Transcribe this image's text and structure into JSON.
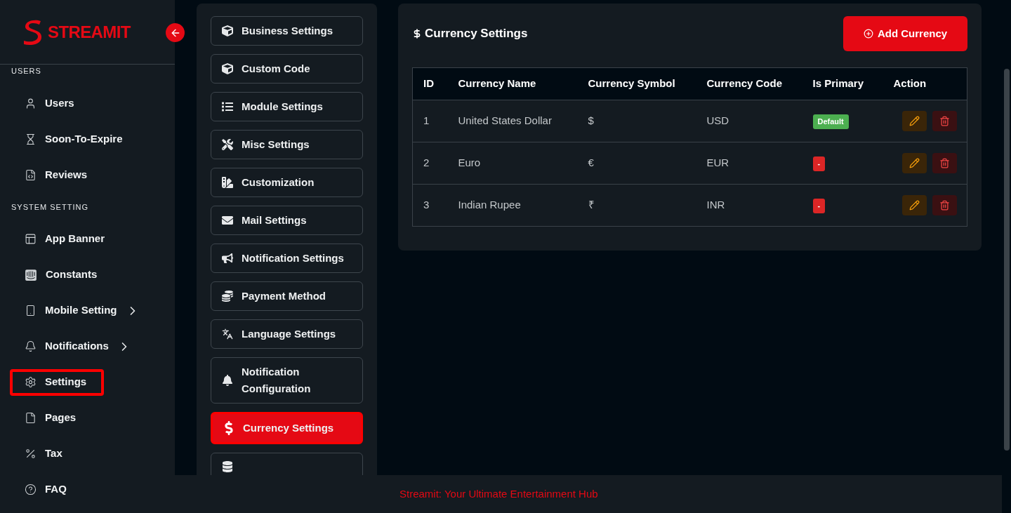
{
  "brand": {
    "name": "STREAMIT"
  },
  "sidebar": {
    "sections": [
      {
        "title": "USERS",
        "items": [
          {
            "label": "Users",
            "selected": false,
            "has_submenu": false
          },
          {
            "label": "Soon-To-Expire",
            "selected": false,
            "has_submenu": false
          },
          {
            "label": "Reviews",
            "selected": false,
            "has_submenu": false
          }
        ]
      },
      {
        "title": "SYSTEM SETTING",
        "items": [
          {
            "label": "App Banner",
            "selected": false,
            "has_submenu": false
          },
          {
            "label": "Constants",
            "selected": false,
            "has_submenu": false
          },
          {
            "label": "Mobile Setting",
            "selected": false,
            "has_submenu": true
          },
          {
            "label": "Notifications",
            "selected": false,
            "has_submenu": true
          },
          {
            "label": "Settings",
            "selected": true,
            "has_submenu": false
          },
          {
            "label": "Pages",
            "selected": false,
            "has_submenu": false
          },
          {
            "label": "Tax",
            "selected": false,
            "has_submenu": false
          },
          {
            "label": "FAQ",
            "selected": false,
            "has_submenu": false
          }
        ]
      }
    ]
  },
  "settings_menu": [
    {
      "label": "Business Settings",
      "selected": false
    },
    {
      "label": "Custom Code",
      "selected": false
    },
    {
      "label": "Module Settings",
      "selected": false
    },
    {
      "label": "Misc Settings",
      "selected": false
    },
    {
      "label": "Customization",
      "selected": false
    },
    {
      "label": "Mail Settings",
      "selected": false
    },
    {
      "label": "Notification Settings",
      "selected": false
    },
    {
      "label": "Payment Method",
      "selected": false
    },
    {
      "label": "Language Settings",
      "selected": false
    },
    {
      "label": "Notification Configuration",
      "selected": false
    },
    {
      "label": "Currency Settings",
      "selected": true
    },
    {
      "selected": false
    }
  ],
  "panel": {
    "title": "Currency Settings",
    "add_button": "Add Currency"
  },
  "table": {
    "columns": [
      "ID",
      "Currency Name",
      "Currency Symbol",
      "Currency Code",
      "Is Primary",
      "Action"
    ],
    "rows": [
      {
        "id": "1",
        "name": "United States Dollar",
        "symbol": "$",
        "code": "USD",
        "primary": true,
        "primary_label": "Default"
      },
      {
        "id": "2",
        "name": "Euro",
        "symbol": "€",
        "code": "EUR",
        "primary": false,
        "primary_label": "-"
      },
      {
        "id": "3",
        "name": "Indian Rupee",
        "symbol": "₹",
        "code": "INR",
        "primary": false,
        "primary_label": "-"
      }
    ]
  },
  "footer": {
    "text": "Streamit: Your Ultimate Entertainment Hub"
  }
}
